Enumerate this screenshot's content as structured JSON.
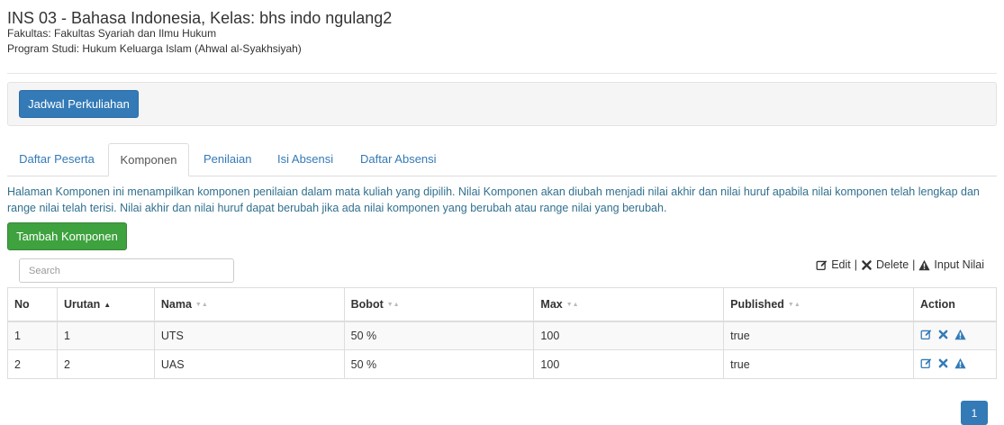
{
  "header": {
    "title": "INS 03 - Bahasa Indonesia, Kelas: bhs indo ngulang2",
    "fakultas": "Fakultas: Fakultas Syariah dan Ilmu Hukum",
    "prodi": "Program Studi: Hukum Keluarga Islam (Ahwal al-Syakhsiyah)"
  },
  "well": {
    "button_label": "Jadwal Perkuliahan"
  },
  "tabs": [
    {
      "label": "Daftar Peserta"
    },
    {
      "label": "Komponen",
      "active": true
    },
    {
      "label": "Penilaian"
    },
    {
      "label": "Isi Absensi"
    },
    {
      "label": "Daftar Absensi"
    }
  ],
  "info_text": "Halaman Komponen ini menampilkan komponen penilaian dalam mata kuliah yang dipilih. Nilai Komponen akan diubah menjadi nilai akhir dan nilai huruf apabila nilai komponen telah lengkap dan range nilai telah terisi. Nilai akhir dan nilai huruf dapat berubah jika ada nilai komponen yang berubah atau range nilai yang berubah.",
  "add_button_label": "Tambah Komponen",
  "search": {
    "placeholder": "Search"
  },
  "legend": {
    "edit": "Edit",
    "separator": "|",
    "delete": "Delete",
    "input_nilai": "Input Nilai"
  },
  "table": {
    "columns": [
      "No",
      "Urutan",
      "Nama",
      "Bobot",
      "Max",
      "Published",
      "Action"
    ],
    "rows": [
      {
        "no": "1",
        "urutan": "1",
        "nama": "UTS",
        "bobot": "50 %",
        "max": "100",
        "published": "true"
      },
      {
        "no": "2",
        "urutan": "2",
        "nama": "UAS",
        "bobot": "50 %",
        "max": "100",
        "published": "true"
      }
    ]
  },
  "pagination": {
    "current_page": "1"
  },
  "colors": {
    "primary": "#337ab7",
    "success": "#3ea23e",
    "info_text": "#31708f",
    "delete_icon": "#337ab7",
    "warning_icon": "#337ab7"
  },
  "icons": {
    "edit": "pencil-square-icon",
    "delete": "x-icon",
    "input_nilai": "warning-triangle-icon"
  }
}
